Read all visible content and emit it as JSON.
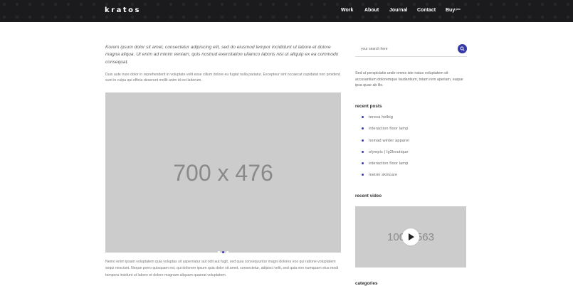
{
  "header": {
    "logo": "kratos",
    "nav": [
      {
        "label": "Work"
      },
      {
        "label": "About"
      },
      {
        "label": "Journal"
      },
      {
        "label": "Contact"
      },
      {
        "label": "Buy",
        "sup": "pro"
      }
    ]
  },
  "main": {
    "intro": "Korem ipsum dolor sit amet, consectetur adipiscing elit, sed do eiusmod tempor incididunt ut labore et dolore magna aliqua. Ut enim ad minim veniam, quis nostrud exercitation ullamco laboris nisi ut aliquip ex ea commodo consequat.",
    "paragraph1": "Duis aute irure dolor in reprehenderit in voluptate velit esse cillum dolore eu fugiat nulla pariatur. Excepteur sint occaecat cupidatat non proident, sunt in culpa qui officia deserunt mollit anim id est laborum.",
    "hero_placeholder": "700 x 476",
    "slider_dots": 3,
    "slider_active": 1,
    "paragraph2": "Nemo enim ipsam voluptatem quia voluptas sit aspernatur aut odit aut fugit, sed quia consequuntur magni dolores eos qui ratione voluptatem sequi nesciunt. Neque porro quisquam est, qui dolorem ipsum quia dolor sit amet, consectetur, adipisci velit, sed quia non numquam eius modi tempora incidunt ut labore et dolore magnam aliquam quaerat voluptatem."
  },
  "sidebar": {
    "search_placeholder": "your search here",
    "about": "Sed ut perspiciatis unde omnis iste natus voluptatem sit accusantium doloremque laudantium, totam rem aperiam, eaque ipsa quae ab illo.",
    "recent_posts_title": "recent posts",
    "recent_posts": [
      "teresa helbig",
      "interaction floor lamp",
      "nomad winter apparel",
      "olympic | lg2boutique",
      "interaction floor lamp",
      "metrin skincare"
    ],
    "recent_video_title": "recent video",
    "video_placeholder": "100 x 563",
    "categories_title": "categories"
  },
  "colors": {
    "header_bg": "#1b1b1d",
    "accent": "#3539a6",
    "placeholder_bg": "#cccccc"
  }
}
